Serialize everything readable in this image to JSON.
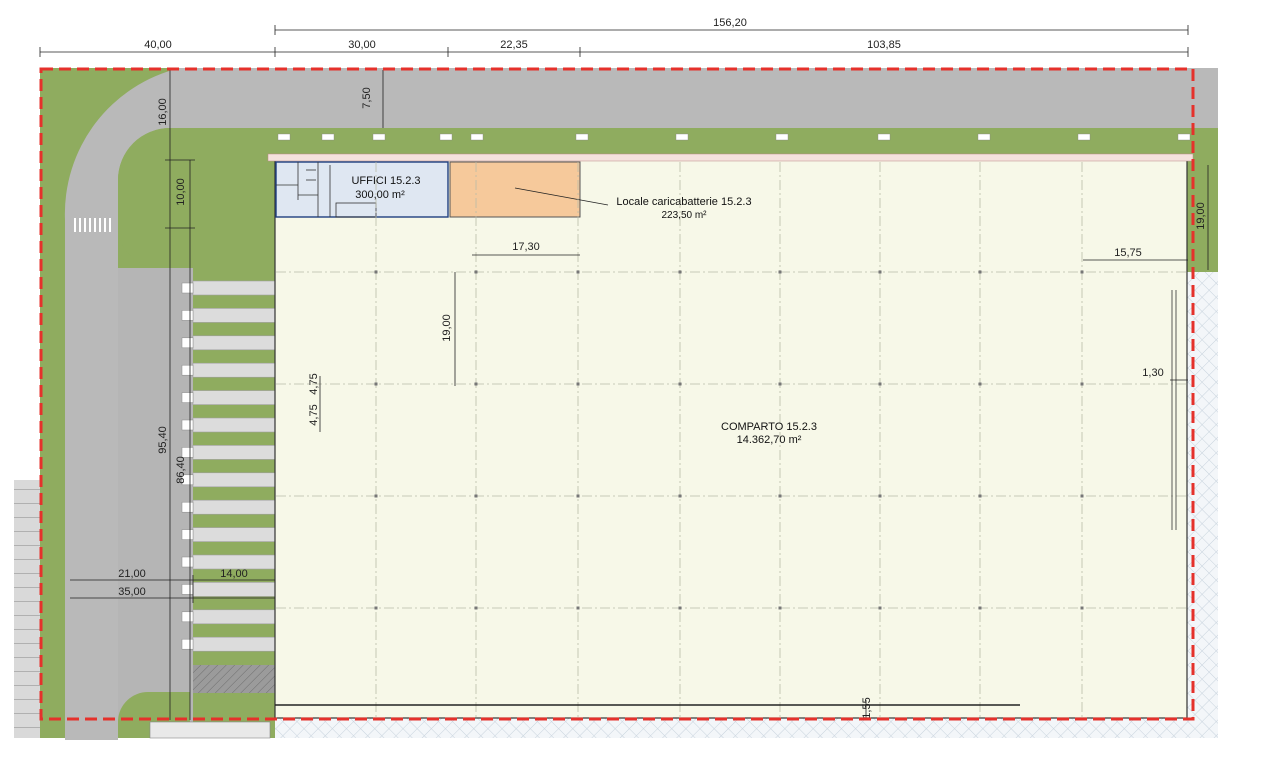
{
  "rooms": {
    "uffici": {
      "name": "UFFICI 15.2.3",
      "area": "300,00 m²"
    },
    "locale": {
      "name": "Locale caricabatterie 15.2.3",
      "area": "223,50 m²"
    },
    "comparto": {
      "name": "COMPARTO 15.2.3",
      "area": "14.362,70 m²"
    }
  },
  "dimensions": {
    "top_total": "156,20",
    "top_40": "40,00",
    "top_30": "30,00",
    "top_2235": "22,35",
    "top_10385": "103,85",
    "road_750": "7,50",
    "left_1600": "16,00",
    "left_1000": "10,00",
    "left_9540": "95,40",
    "left_8540": "86,40",
    "bay_1730": "17,30",
    "bay_1900": "19,00",
    "bay_475": "4,75",
    "bay_475b": "4,75",
    "bottom_2100": "21,00",
    "bottom_3500": "35,00",
    "bottom_1400": "14,00",
    "right_1575": "15,75",
    "right_1900": "19,00",
    "right_130": "1,30",
    "bottom_155": "1,55"
  },
  "colors": {
    "grass": "#8fac5f",
    "road": "#b9b9b9",
    "building": "#f7f8e8",
    "office": "#dfe7f2",
    "charging": "#f6c99b",
    "boundary": "#e5312b"
  }
}
